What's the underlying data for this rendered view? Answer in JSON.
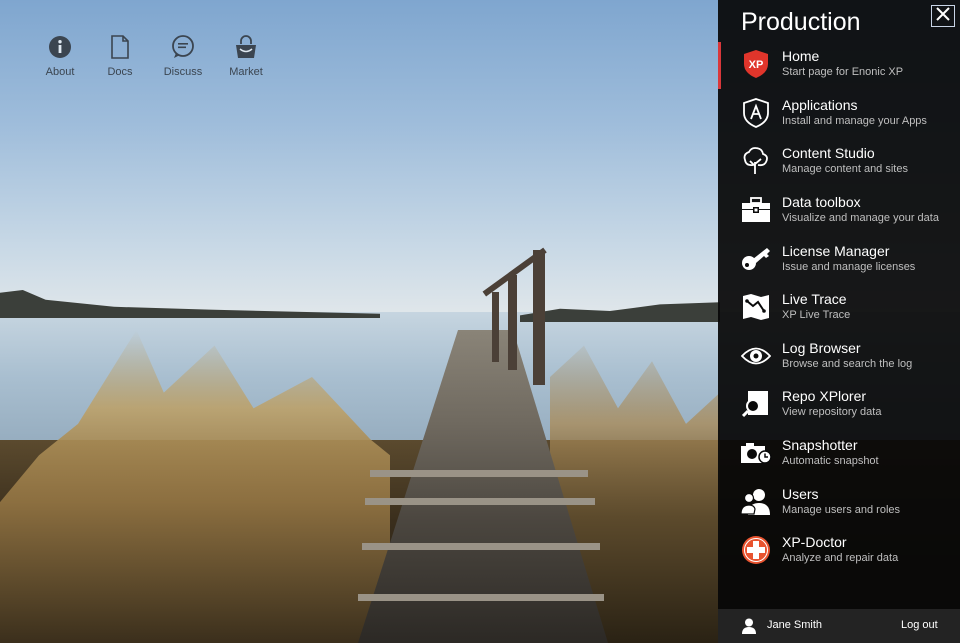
{
  "quick_links": [
    {
      "label": "About",
      "icon": "info-icon"
    },
    {
      "label": "Docs",
      "icon": "document-icon"
    },
    {
      "label": "Discuss",
      "icon": "chat-bubble-icon"
    },
    {
      "label": "Market",
      "icon": "shopping-bag-icon"
    }
  ],
  "panel": {
    "title": "Production",
    "accent_color": "#d9383b",
    "items": [
      {
        "title": "Home",
        "subtitle": "Start page for Enonic XP",
        "icon": "xp-shield-icon",
        "active": true
      },
      {
        "title": "Applications",
        "subtitle": "Install and manage your Apps",
        "icon": "applications-icon"
      },
      {
        "title": "Content Studio",
        "subtitle": "Manage content and sites",
        "icon": "tree-icon"
      },
      {
        "title": "Data toolbox",
        "subtitle": "Visualize and manage your data",
        "icon": "toolbox-icon"
      },
      {
        "title": "License Manager",
        "subtitle": "Issue and manage licenses",
        "icon": "key-icon"
      },
      {
        "title": "Live Trace",
        "subtitle": "XP Live Trace",
        "icon": "trace-map-icon"
      },
      {
        "title": "Log Browser",
        "subtitle": "Browse and search the log",
        "icon": "eye-icon"
      },
      {
        "title": "Repo XPlorer",
        "subtitle": "View repository data",
        "icon": "magnifier-icon"
      },
      {
        "title": "Snapshotter",
        "subtitle": "Automatic snapshot",
        "icon": "camera-clock-icon"
      },
      {
        "title": "Users",
        "subtitle": "Manage users and roles",
        "icon": "users-icon"
      },
      {
        "title": "XP-Doctor",
        "subtitle": "Analyze and repair data",
        "icon": "medical-cross-icon"
      }
    ]
  },
  "footer": {
    "user_name": "Jane Smith",
    "logout_label": "Log out"
  }
}
